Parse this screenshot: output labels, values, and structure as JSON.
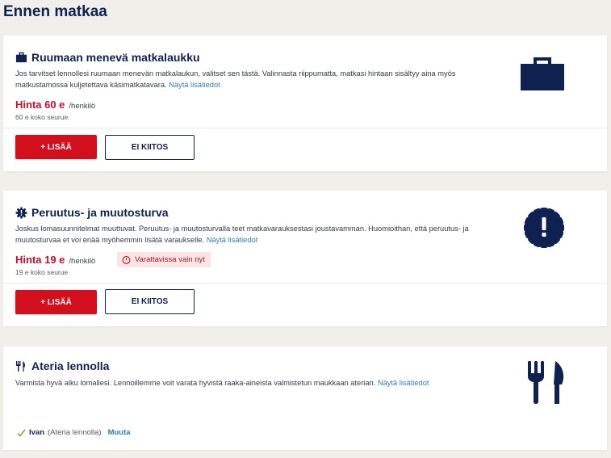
{
  "page": {
    "title": "Ennen matkaa"
  },
  "cards": {
    "luggage": {
      "title": "Ruumaan menevä matkalaukku",
      "description": "Jos tarvitset lennollesi ruumaan menevän matkalaukun, valitset sen tästä. Valinnasta riippumatta, matkasi hintaan sisältyy aina myös matkustamossa kuljetettava käsimatkatavara.",
      "more_link": "Näytä lisätiedot",
      "price": "Hinta 60 e",
      "per_person": "/henkilö",
      "group_price": "60 e koko seurue",
      "add_button": "+ LISÄÄ",
      "decline_button": "EI KIITOS",
      "icon": "suitcase-icon"
    },
    "cancellation": {
      "title": "Peruutus- ja muutosturva",
      "description": "Joskus lomasuunnitelmat muuttuvat. Peruutus- ja muutosturvalla teet matkavarauksestasi joustavamman. Huomioithan, että peruutus- ja muutosturvaa et voi enää myöhemmin lisätä varaukselle.",
      "more_link": "Näytä lisätiedot",
      "price": "Hinta 19 e",
      "per_person": "/henkilö",
      "group_price": "19 e koko seurue",
      "badge": "Varattavissa vain nyt",
      "add_button": "+ LISÄÄ",
      "decline_button": "EI KIITOS",
      "icon": "gear-badge-icon"
    },
    "meal": {
      "title": "Ateria lennolla",
      "description": "Varmista hyvä alku lomallesi. Lennoillemme voit varata hyvistä raaka-aineista valmistetun maukkaan aterian.",
      "more_link": "Näytä lisätiedot",
      "selected_name": "Ivan",
      "selected_meal": "(Ateria lennolla)",
      "change_link": "Muuta",
      "icon": "fork-knife-icon"
    }
  },
  "colors": {
    "navy": "#0e2150",
    "red": "#d30f1e",
    "price_red": "#c8102e",
    "link": "#2f7fb7",
    "background": "#f1efea",
    "check_green": "#6ab023"
  }
}
